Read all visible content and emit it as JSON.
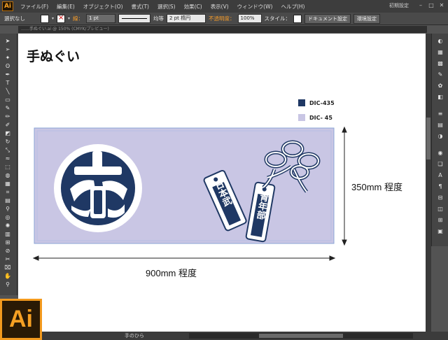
{
  "app": {
    "logo": "Ai",
    "menus": [
      "ファイル(F)",
      "編集(E)",
      "オブジェクト(O)",
      "書式(T)",
      "選択(S)",
      "効果(C)",
      "表示(V)",
      "ウィンドウ(W)",
      "ヘルプ(H)"
    ],
    "workspace": "初期設定"
  },
  "control_bar": {
    "selection": "選択なし",
    "stroke_label": "線：",
    "stroke_weight": "1 pt",
    "stroke_profile": "均等",
    "brush": "2 pt 楕円",
    "opacity_label": "不透明度：",
    "opacity_value": "100%",
    "style_label": "スタイル：",
    "doc_setup_button": "ドキュメント設定",
    "prefs_button": "環境設定"
  },
  "tab_title": "……手ぬぐい.ai @ 150% (CMYK/プレビュー)",
  "document": {
    "title": "手ぬぐい",
    "legend": [
      {
        "label": "DIC-435",
        "color": "#1f3864"
      },
      {
        "label": "DIC-  45",
        "color": "#c9c6e4"
      }
    ],
    "width_label": "900mm 程度",
    "height_label": "350mm 程度",
    "tag_left_text": "日本武",
    "tag_right_text": "青年部",
    "crest_text": "宏"
  },
  "status": {
    "tool_name": "手のひら"
  },
  "colors": {
    "navy": "#1f3864",
    "lavender": "#c9c6e4"
  }
}
